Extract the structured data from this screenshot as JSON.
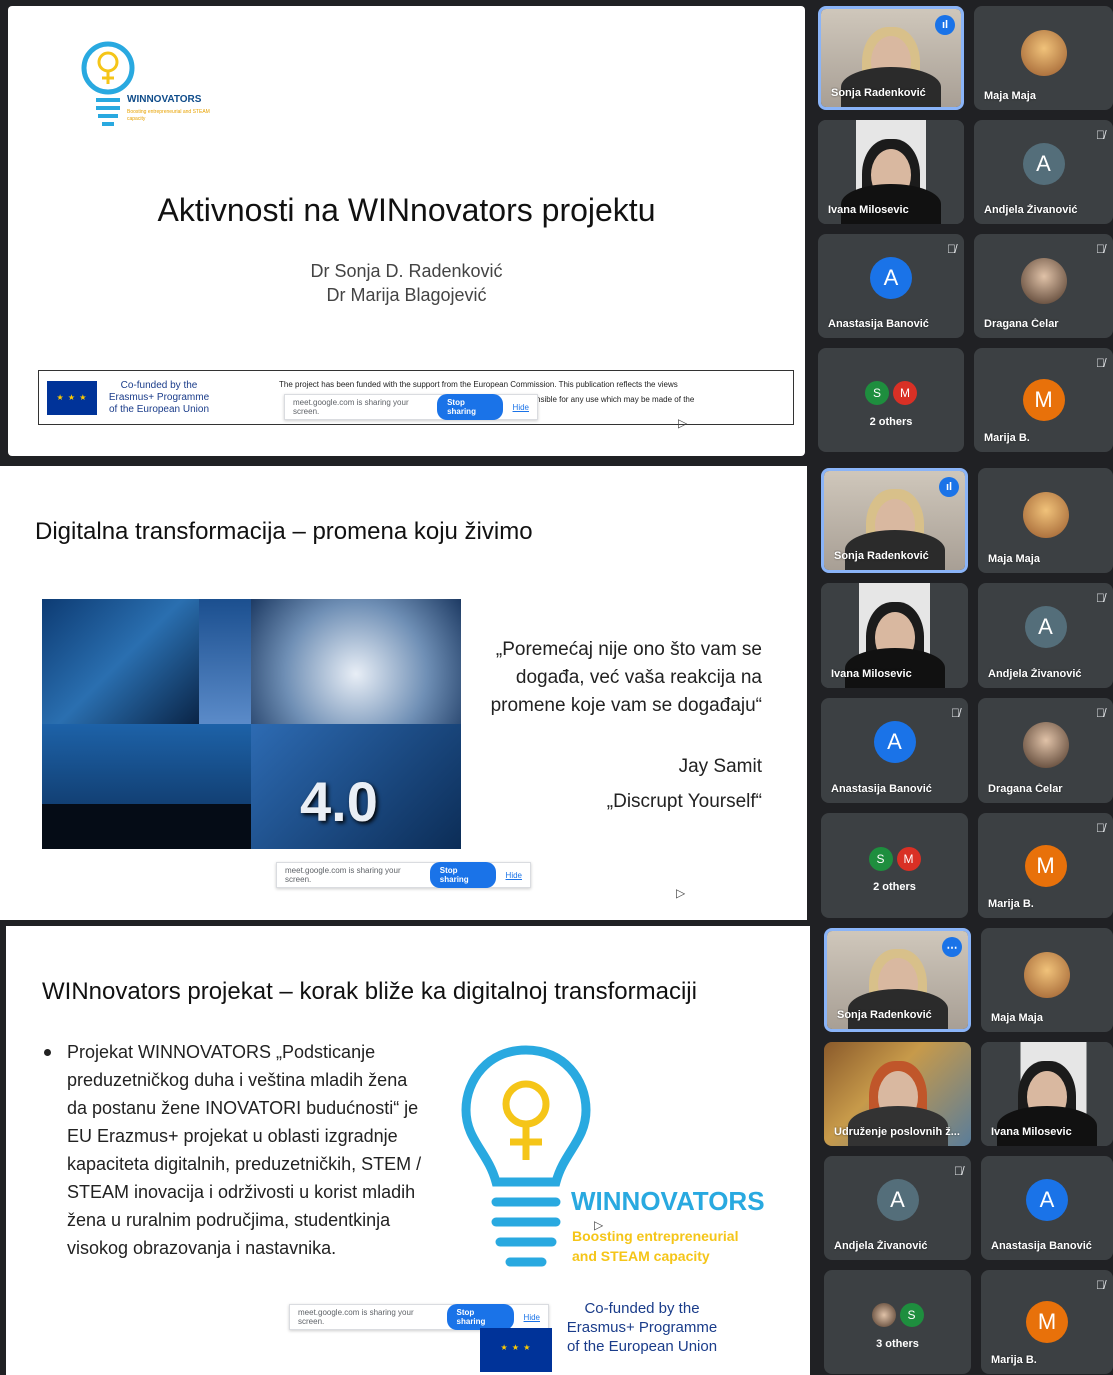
{
  "panel1": {
    "logo_name": "WINNOVATORS",
    "logo_tagline": "Boosting entrepreneurial and STEAM capacity",
    "title": "Aktivnosti na WINnovators projektu",
    "author1": "Dr Sonja D. Radenković",
    "author2": "Dr Marija Blagojević",
    "cofunded": "Co-funded by the Erasmus+ Programme of the European Union",
    "disclaimer_a": "The project has been funded with the support from the European Commission. This publication reflects the views",
    "disclaimer_b": "nsible for any use which may be made of the",
    "share_text": "meet.google.com is sharing your screen.",
    "stop_label": "Stop sharing",
    "hide_label": "Hide",
    "participants": [
      {
        "name": "Sonja Radenković"
      },
      {
        "name": "Maja Maja"
      },
      {
        "name": "Ivana Milosevic"
      },
      {
        "name": "Andjela Živanović",
        "initial": "A"
      },
      {
        "name": "Anastasija Banović",
        "initial": "A"
      },
      {
        "name": "Dragana Čelar"
      },
      {
        "name": "2 others",
        "a": "S",
        "b": "M"
      },
      {
        "name": "Marija B.",
        "initial": "M"
      }
    ]
  },
  "panel2": {
    "title": "Digitalna transformacija – promena koju živimo",
    "image_label": "4.0",
    "quote": "„Poremećaj nije ono što vam se događa, već vaša  reakcija na promene koje vam se događaju“",
    "author": "Jay Samit",
    "book": "„Discrupt Yourself“",
    "share_text": "meet.google.com is sharing your screen.",
    "stop_label": "Stop sharing",
    "hide_label": "Hide",
    "participants": [
      {
        "name": "Sonja Radenković"
      },
      {
        "name": "Maja Maja"
      },
      {
        "name": "Ivana Milosevic"
      },
      {
        "name": "Andjela Živanović",
        "initial": "A"
      },
      {
        "name": "Anastasija Banović",
        "initial": "A"
      },
      {
        "name": "Dragana Čelar"
      },
      {
        "name": "2 others",
        "a": "S",
        "b": "M"
      },
      {
        "name": "Marija B.",
        "initial": "M"
      }
    ]
  },
  "panel3": {
    "title": "WINnovators projekat – korak bliže ka digitalnoj transformaciji",
    "bullet": "Projekat WINNOVATORS „Podsticanje preduzetničkog duha i veština mladih žena da postanu žene INOVATORI budućnosti“ je EU Erazmus+ projekat u oblasti izgradnje kapaciteta digitalnih, preduzetničkih, STEM / STEAM inovacija i održivosti u korist mladih žena u ruralnim područjima, studentkinja visokog obrazovanja i nastavnika.",
    "logo_name": "WINNOVATORS",
    "logo_tag1": "Boosting entrepreneurial",
    "logo_tag2": "and STEAM capacity",
    "cof1": "Co-funded by the",
    "cof2": "Erasmus+ Programme",
    "cof3": "of the European Union",
    "share_text": "meet.google.com is sharing your screen.",
    "stop_label": "Stop sharing",
    "hide_label": "Hide",
    "participants": [
      {
        "name": "Sonja Radenković"
      },
      {
        "name": "Maja Maja"
      },
      {
        "name": "Udruženje poslovnih ž..."
      },
      {
        "name": "Ivana Milosevic"
      },
      {
        "name": "Andjela Živanović",
        "initial": "A"
      },
      {
        "name": "Anastasija Banović",
        "initial": "A"
      },
      {
        "name": "3 others",
        "b": "S"
      },
      {
        "name": "Marija B.",
        "initial": "M"
      }
    ]
  },
  "colors": {
    "meet_bg": "#202124",
    "tile": "#3c4043",
    "blue": "#1a73e8",
    "orange": "#e8710a",
    "green": "#1e8e3e",
    "red": "#d93025",
    "logo_blue": "#29a9e0",
    "logo_yellow": "#f5c518"
  }
}
